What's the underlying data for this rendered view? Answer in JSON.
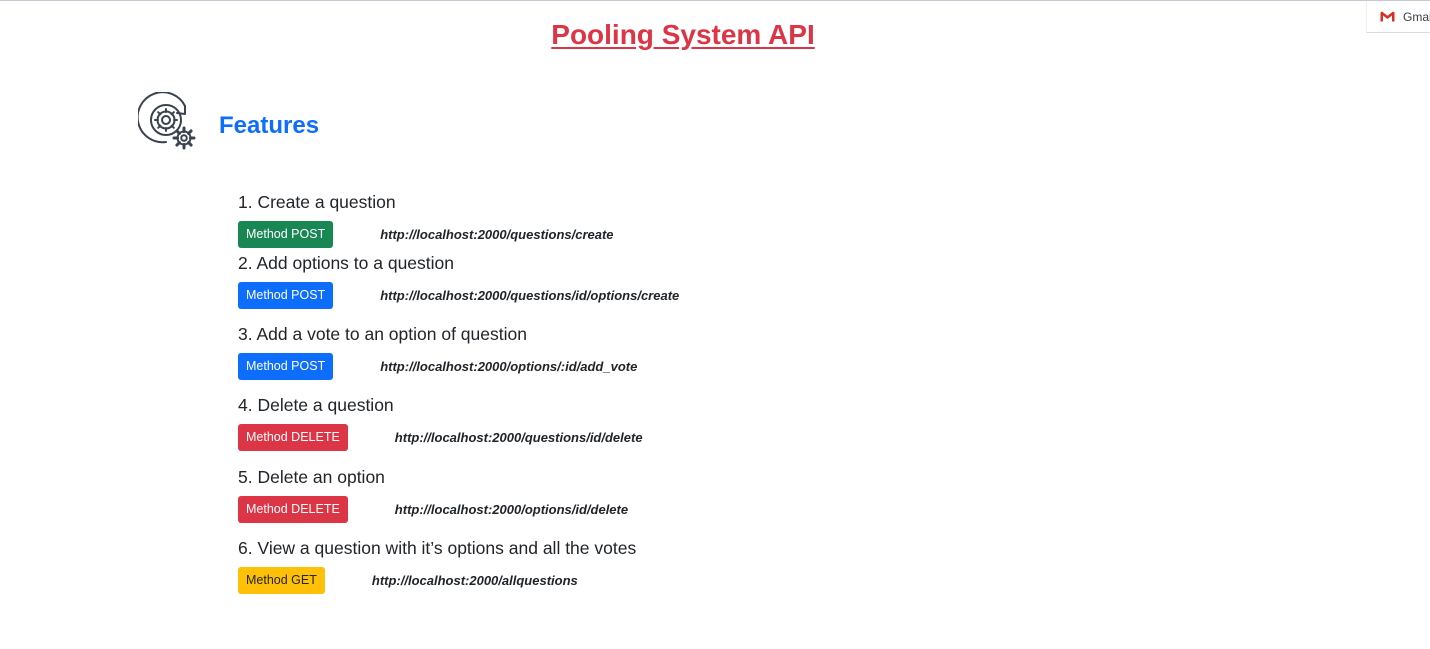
{
  "page": {
    "title": "Pooling System API",
    "section_title": "Features"
  },
  "tab_chip": {
    "label": "Gmail",
    "icon": "gmail-icon"
  },
  "features": [
    {
      "label": "1. Create a question",
      "method": "Method POST",
      "url": "http://localhost:2000/questions/create",
      "color": "#198754"
    },
    {
      "label": "2. Add options to a question",
      "method": "Method POST",
      "url": "http://localhost:2000/questions/id/options/create",
      "color": "#0d6efd"
    },
    {
      "label": "3. Add a vote to an option of question",
      "method": "Method POST",
      "url": "http://localhost:2000/options/:id/add_vote",
      "color": "#0d6efd"
    },
    {
      "label": "4. Delete a question",
      "method": "Method DELETE",
      "url": "http://localhost:2000/questions/id/delete",
      "color": "#dc3545"
    },
    {
      "label": "5. Delete an option",
      "method": "Method DELETE",
      "url": "http://localhost:2000/options/id/delete",
      "color": "#dc3545"
    },
    {
      "label": "6. View a question with it’s options and all the votes",
      "method": "Method GET",
      "url": "http://localhost:2000/allquestions",
      "color": "#ffc107"
    }
  ],
  "colors": {
    "title": "#dc3545",
    "section_title": "#0d6efd"
  }
}
